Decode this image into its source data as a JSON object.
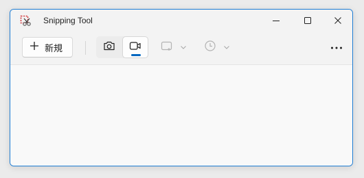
{
  "window": {
    "title": "Snipping Tool",
    "accent_color": "#0067c0",
    "border_color": "#1d7cd4"
  },
  "titlebar": {
    "app_icon": "scissors-icon",
    "buttons": [
      {
        "name": "minimize",
        "icon": "minimize-icon"
      },
      {
        "name": "maximize",
        "icon": "maximize-icon"
      },
      {
        "name": "close",
        "icon": "close-icon"
      }
    ]
  },
  "toolbar": {
    "new_button": {
      "label": "新規",
      "icon": "plus-icon"
    },
    "modes": [
      {
        "name": "screenshot",
        "icon": "camera-icon",
        "selected": false
      },
      {
        "name": "record",
        "icon": "video-camera-icon",
        "selected": true
      }
    ],
    "shape_dropdown": {
      "icon": "rectangle-snip-icon",
      "enabled": false
    },
    "delay_dropdown": {
      "icon": "clock-icon",
      "enabled": false
    },
    "more_button": {
      "icon": "more-icon"
    }
  }
}
